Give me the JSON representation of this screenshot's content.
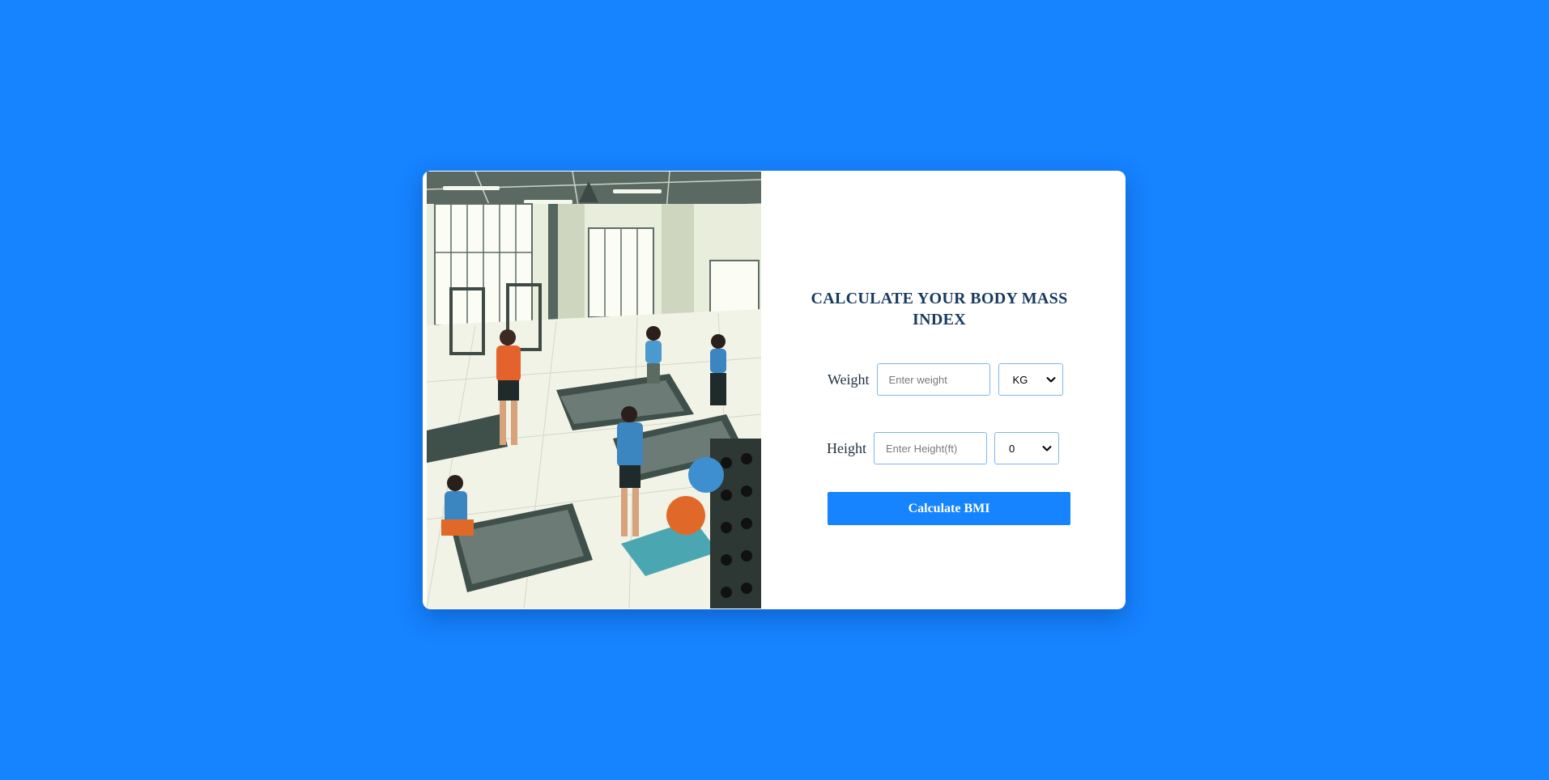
{
  "colors": {
    "background": "#1683ff",
    "card": "#ffffff",
    "title": "#173a5e",
    "button": "#1683ff",
    "input_border": "#7fb6ef"
  },
  "illustration": {
    "subject": "gym-scene-illustration"
  },
  "form": {
    "title": "CALCULATE YOUR BODY MASS INDEX",
    "weight": {
      "label": "Weight",
      "placeholder": "Enter weight",
      "value": "",
      "unit_selected": "KG"
    },
    "height": {
      "label": "Height",
      "placeholder": "Enter Height(ft)",
      "value": "",
      "inches_selected": "0"
    },
    "submit_label": "Calculate BMI"
  },
  "icons": {
    "dropdown": "chevron-down-icon"
  }
}
